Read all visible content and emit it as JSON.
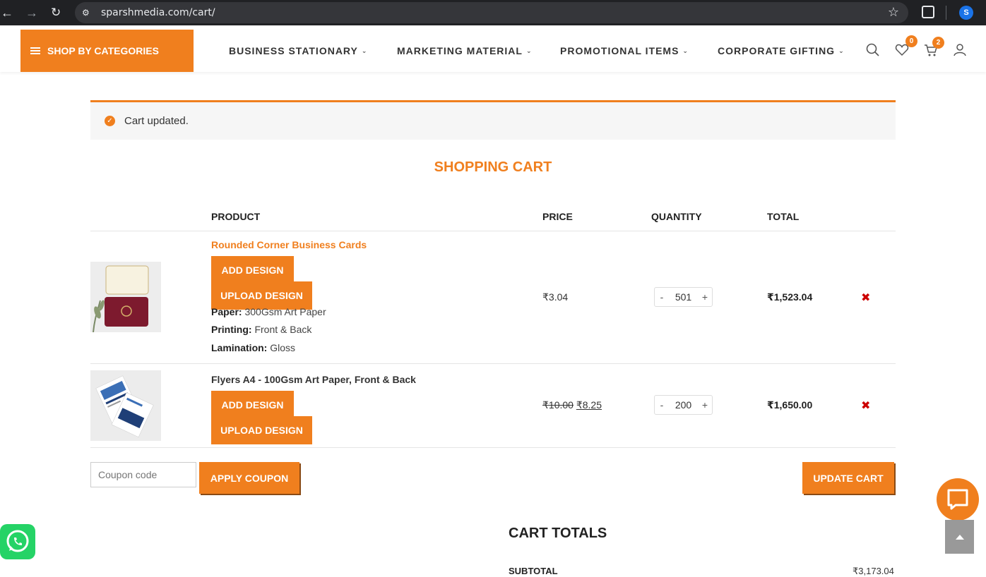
{
  "browser": {
    "url": "sparshmedia.com/cart/",
    "profile_initial": "S"
  },
  "header": {
    "categories_label": "SHOP BY CATEGORIES",
    "menu": [
      {
        "label": "BUSINESS STATIONARY"
      },
      {
        "label": "MARKETING MATERIAL"
      },
      {
        "label": "PROMOTIONAL ITEMS"
      },
      {
        "label": "CORPORATE GIFTING"
      }
    ],
    "wishlist_count": "0",
    "cart_count": "2"
  },
  "notice": {
    "message": "Cart updated."
  },
  "page_title": "SHOPPING CART",
  "table": {
    "headers": {
      "product": "PRODUCT",
      "price": "PRICE",
      "quantity": "QUANTITY",
      "total": "TOTAL"
    },
    "rows": [
      {
        "name": "Rounded Corner Business Cards",
        "add_design": "ADD DESIGN",
        "upload_design": "UPLOAD DESIGN",
        "meta": [
          {
            "label": "Paper:",
            "value": "300Gsm Art Paper"
          },
          {
            "label": "Printing:",
            "value": "Front & Back"
          },
          {
            "label": "Lamination:",
            "value": "Gloss"
          }
        ],
        "price": "₹3.04",
        "quantity": "501",
        "total": "₹1,523.04"
      },
      {
        "name": "Flyers A4 - 100Gsm Art Paper, Front & Back",
        "add_design": "ADD DESIGN",
        "upload_design": "UPLOAD DESIGN",
        "price_old": "₹10.00",
        "price_new": "₹8.25",
        "quantity": "200",
        "total": "₹1,650.00"
      }
    ],
    "qty_minus": "-",
    "qty_plus": "+",
    "remove_symbol": "✖"
  },
  "coupon": {
    "placeholder": "Coupon code",
    "apply_label": "APPLY COUPON"
  },
  "update_cart_label": "UPDATE CART",
  "totals": {
    "title": "CART TOTALS",
    "subtotal_label": "SUBTOTAL",
    "subtotal_value": "₹3,173.04"
  },
  "colors": {
    "accent": "#f07f1e",
    "remove": "#cc0000",
    "whatsapp": "#25d366"
  }
}
